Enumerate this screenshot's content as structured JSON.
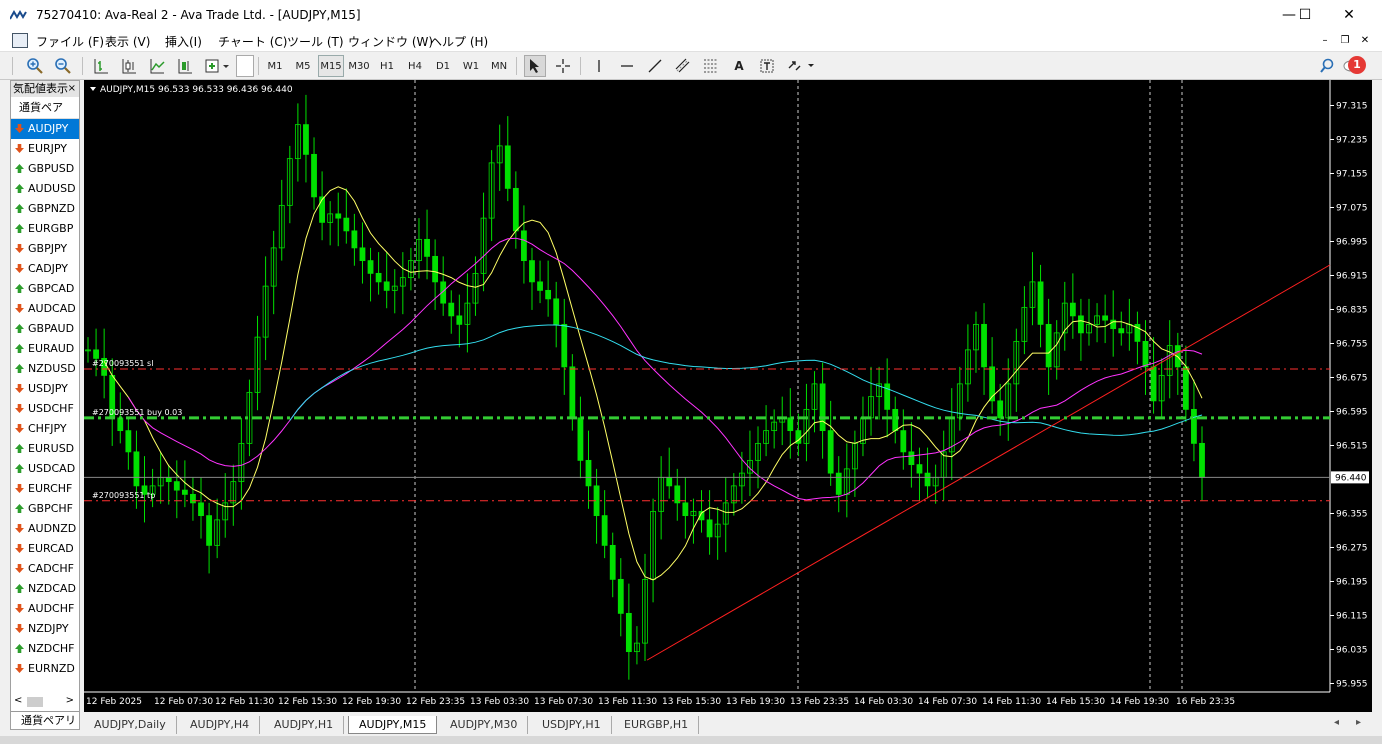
{
  "window": {
    "title": "75270410: Ava-Real 2 - Ava Trade Ltd. - [AUDJPY,M15]",
    "controls": {
      "minimize": "—",
      "maximize": "☐",
      "close": "✕"
    }
  },
  "menu": {
    "items": [
      "ファイル (F)",
      "表示 (V)",
      "挿入(I)",
      "チャート (C)",
      "ツール (T)",
      "ウィンドウ (W)",
      "ヘルプ (H)"
    ],
    "mdi": {
      "minimize": "–",
      "restore": "❐",
      "close": "✕"
    }
  },
  "toolbar": {
    "timeframes": [
      "M1",
      "M5",
      "M15",
      "M30",
      "H1",
      "H4",
      "D1",
      "W1",
      "MN"
    ],
    "active_timeframe": "M15",
    "text_tool": "A",
    "notification_count": "1"
  },
  "market_watch": {
    "title": "気配値表示",
    "close": "×",
    "header": "通貨ペア",
    "symbols": [
      {
        "name": "AUDJPY",
        "dir": "down",
        "selected": true
      },
      {
        "name": "EURJPY",
        "dir": "down"
      },
      {
        "name": "GBPUSD",
        "dir": "up"
      },
      {
        "name": "AUDUSD",
        "dir": "up"
      },
      {
        "name": "GBPNZD",
        "dir": "up"
      },
      {
        "name": "EURGBP",
        "dir": "up"
      },
      {
        "name": "GBPJPY",
        "dir": "down"
      },
      {
        "name": "CADJPY",
        "dir": "down"
      },
      {
        "name": "GBPCAD",
        "dir": "up"
      },
      {
        "name": "AUDCAD",
        "dir": "down"
      },
      {
        "name": "GBPAUD",
        "dir": "up"
      },
      {
        "name": "EURAUD",
        "dir": "up"
      },
      {
        "name": "NZDUSD",
        "dir": "up"
      },
      {
        "name": "USDJPY",
        "dir": "down"
      },
      {
        "name": "USDCHF",
        "dir": "down"
      },
      {
        "name": "CHFJPY",
        "dir": "down"
      },
      {
        "name": "EURUSD",
        "dir": "up"
      },
      {
        "name": "USDCAD",
        "dir": "up"
      },
      {
        "name": "EURCHF",
        "dir": "down"
      },
      {
        "name": "GBPCHF",
        "dir": "up"
      },
      {
        "name": "AUDNZD",
        "dir": "down"
      },
      {
        "name": "EURCAD",
        "dir": "down"
      },
      {
        "name": "CADCHF",
        "dir": "down"
      },
      {
        "name": "NZDCAD",
        "dir": "up"
      },
      {
        "name": "AUDCHF",
        "dir": "down"
      },
      {
        "name": "NZDJPY",
        "dir": "down"
      },
      {
        "name": "NZDCHF",
        "dir": "up"
      },
      {
        "name": "EURNZD",
        "dir": "down"
      }
    ],
    "tab": "通貨ペアリ",
    "scroll_left": "<",
    "scroll_right": ">"
  },
  "chart": {
    "header": "AUDJPY,M15  96.533 96.533 96.436 96.440",
    "current_price": "96.440",
    "price_axis": [
      "97.315",
      "97.235",
      "97.155",
      "97.075",
      "96.995",
      "96.915",
      "96.835",
      "96.755",
      "96.675",
      "96.595",
      "96.515",
      "96.355",
      "96.275",
      "96.195",
      "96.115",
      "96.035",
      "95.955"
    ],
    "time_axis": [
      "12 Feb 2025",
      "12 Feb 07:30",
      "12 Feb 11:30",
      "12 Feb 15:30",
      "12 Feb 19:30",
      "12 Feb 23:35",
      "13 Feb 03:30",
      "13 Feb 07:30",
      "13 Feb 11:30",
      "13 Feb 15:30",
      "13 Feb 19:30",
      "13 Feb 23:35",
      "14 Feb 03:30",
      "14 Feb 07:30",
      "14 Feb 11:30",
      "14 Feb 15:30",
      "14 Feb 19:30",
      "16 Feb 23:35"
    ],
    "order_labels": {
      "sl": "#270093551 sl",
      "entry": "#270093551 buy 0.03",
      "tp": "#270093551 tp"
    },
    "colors": {
      "background": "#000000",
      "candle": "#00e000",
      "ma_fast": "#ffff66",
      "ma_mid": "#ff33ff",
      "ma_slow": "#33ddee",
      "trendline": "#ff2020",
      "sl_tp_line": "#ff3030",
      "entry_line": "#33cc33"
    },
    "price_samples": [
      96.74,
      96.72,
      96.68,
      96.58,
      96.55,
      96.5,
      96.42,
      96.4,
      96.42,
      96.44,
      96.43,
      96.41,
      96.4,
      96.38,
      96.35,
      96.28,
      96.34,
      96.38,
      96.43,
      96.52,
      96.64,
      96.77,
      96.89,
      96.98,
      97.08,
      97.19,
      97.27,
      97.2,
      97.1,
      97.04,
      97.06,
      97.05,
      97.02,
      96.98,
      96.95,
      96.92,
      96.9,
      96.88,
      96.89,
      96.91,
      96.95,
      97.0,
      96.96,
      96.9,
      96.85,
      96.82,
      96.8,
      96.85,
      96.92,
      97.05,
      97.18,
      97.22,
      97.12,
      97.02,
      96.95,
      96.9,
      96.88,
      96.86,
      96.8,
      96.7,
      96.58,
      96.48,
      96.42,
      96.35,
      96.28,
      96.2,
      96.12,
      96.03,
      96.05,
      96.2,
      96.36,
      96.44,
      96.42,
      96.38,
      96.35,
      96.36,
      96.34,
      96.3,
      96.33,
      96.38,
      96.42,
      96.45,
      96.48,
      96.52,
      96.55,
      96.57,
      96.58,
      96.55,
      96.52,
      96.6,
      96.66,
      96.55,
      96.45,
      96.4,
      96.46,
      96.52,
      96.58,
      96.63,
      96.66,
      96.6,
      96.55,
      96.5,
      96.47,
      96.45,
      96.42,
      96.44,
      96.5,
      96.58,
      96.66,
      96.74,
      96.8,
      96.7,
      96.62,
      96.58,
      96.66,
      96.76,
      96.84,
      96.9,
      96.8,
      96.7,
      96.78,
      96.85,
      96.82,
      96.78,
      96.8,
      96.82,
      96.81,
      96.79,
      96.78,
      96.8,
      96.76,
      96.7,
      96.62,
      96.68,
      96.75,
      96.7,
      96.6,
      96.52,
      96.44
    ]
  },
  "tabs": {
    "items": [
      "AUDJPY,Daily",
      "AUDJPY,H4",
      "AUDJPY,H1",
      "AUDJPY,M15",
      "AUDJPY,M30",
      "USDJPY,H1",
      "EURGBP,H1"
    ],
    "active": "AUDJPY,M15",
    "nav_left": "◂",
    "nav_right": "▸"
  }
}
